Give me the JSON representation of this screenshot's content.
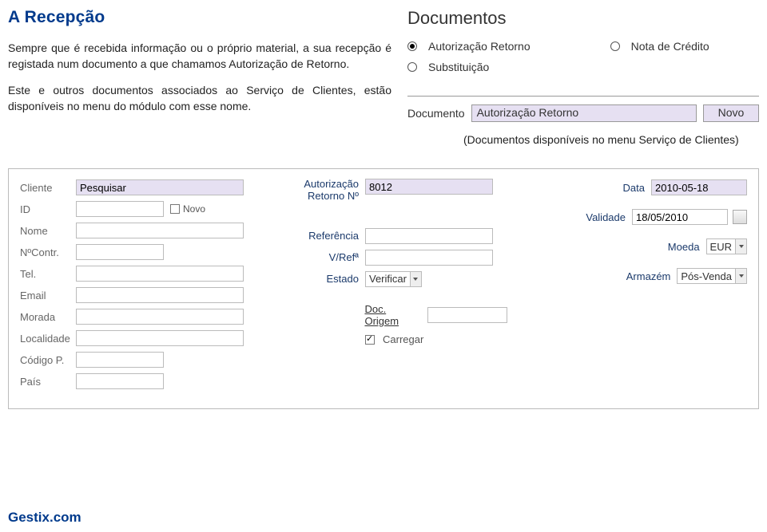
{
  "title": "A Recepção",
  "paragraph1": "Sempre que é recebida informação ou o próprio material, a sua recepção é registada num documento a que chamamos Autorização de Retorno.",
  "paragraph2": "Este e outros documentos associados ao Serviço de Clientes, estão disponíveis no menu do módulo com esse nome.",
  "docs_heading": "Documentos",
  "radios": {
    "autorizacao": "Autorização Retorno",
    "substituicao": "Substituição",
    "nota_credito": "Nota de Crédito"
  },
  "doc_label": "Documento",
  "doc_value": "Autorização Retorno",
  "novo_label": "Novo",
  "caption": "(Documentos disponíveis no menu Serviço de Clientes)",
  "form": {
    "a": {
      "cliente_label": "Cliente",
      "cliente_value": "Pesquisar",
      "id_label": "ID",
      "novo_label": "Novo",
      "nome_label": "Nome",
      "ncontr_label": "NºContr.",
      "tel_label": "Tel.",
      "email_label": "Email",
      "morada_label": "Morada",
      "localidade_label": "Localidade",
      "codigop_label": "Código P.",
      "pais_label": "País"
    },
    "b": {
      "autret_label1": "Autorização",
      "autret_label2": "Retorno Nº",
      "autret_value": "8012",
      "referencia_label": "Referência",
      "vref_label": "V/Refª",
      "estado_label": "Estado",
      "estado_value": "Verificar",
      "docorigem_label": "Doc. Origem",
      "carregar_label": "Carregar"
    },
    "c": {
      "data_label": "Data",
      "data_value": "2010-05-18",
      "validade_label": "Validade",
      "validade_value": "18/05/2010",
      "moeda_label": "Moeda",
      "moeda_value": "EUR",
      "armazem_label": "Armazém",
      "armazem_value": "Pós-Venda"
    }
  },
  "footer": "Gestix.com"
}
